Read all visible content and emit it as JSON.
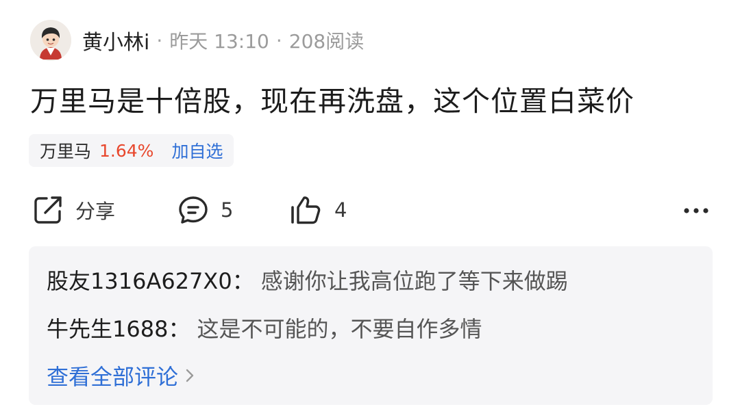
{
  "post": {
    "author": "黄小林i",
    "separator": "·",
    "time": "昨天 13:10",
    "reads": "208阅读",
    "title": "万里马是十倍股，现在再洗盘，这个位置白菜价"
  },
  "stock": {
    "name": "万里马",
    "change": "1.64%",
    "add_label": "加自选",
    "change_color": "#e8472c",
    "link_color": "#2f6fd6"
  },
  "actions": {
    "share_label": "分享",
    "comment_count": "5",
    "like_count": "4",
    "icons": [
      "share-icon",
      "comment-icon",
      "thumbs-up-icon",
      "more-icon"
    ]
  },
  "comments": {
    "items": [
      {
        "user": "股友1316A627X0",
        "colon": "：",
        "text": "感谢你让我高位跑了等下来做踢"
      },
      {
        "user": "牛先生1688",
        "colon": "：",
        "text": "这是不可能的，不要自作多情"
      }
    ],
    "view_all_label": "查看全部评论",
    "view_all_icon": "chevron-right-icon"
  }
}
